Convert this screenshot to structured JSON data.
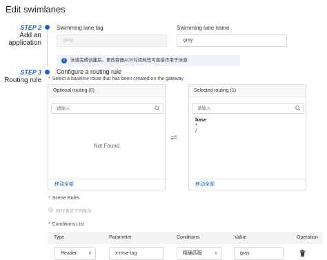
{
  "dialog": {
    "title": "Edit swimlanes"
  },
  "steps": [
    {
      "tag": "STEP 2",
      "name_line1": "Add an",
      "name_line2": "application"
    },
    {
      "tag": "STEP 3",
      "name_line1": "Routing rule"
    }
  ],
  "app": {
    "tag_label": "Swimming lane tag",
    "tag_value": "gray",
    "name_label": "Swimming lane name",
    "name_value": "gray",
    "notice": "泳道完成创建后，更改容器ACK对应标签可直接作用于泳道"
  },
  "routing": {
    "title": "Configure a routing rule",
    "subtitle": "Select a baseline route that has been created on the gateway",
    "optional": {
      "header": "Optional routing (0)",
      "search_placeholder": "请输入",
      "empty_text": "Not Found",
      "footer": "移动全部"
    },
    "selected": {
      "header": "Selected routing (1)",
      "search_placeholder": "请输入",
      "items": [
        "base",
        "*",
        "/"
      ],
      "footer": "移动全部"
    },
    "swap_symbol": "⇌"
  },
  "scene": {
    "label": "Scene Rules",
    "option": "同时满足下列条件"
  },
  "conditions": {
    "label": "Conditions List",
    "columns": [
      "Type",
      "Parameter",
      "Conditions",
      "Value",
      "Operation"
    ],
    "row": {
      "type": "Header",
      "parameter": "x-mse-tag",
      "condition": "精确匹配",
      "value": "gray"
    }
  },
  "colors": {
    "accent": "#1f5fbf",
    "required": "#e54545"
  }
}
